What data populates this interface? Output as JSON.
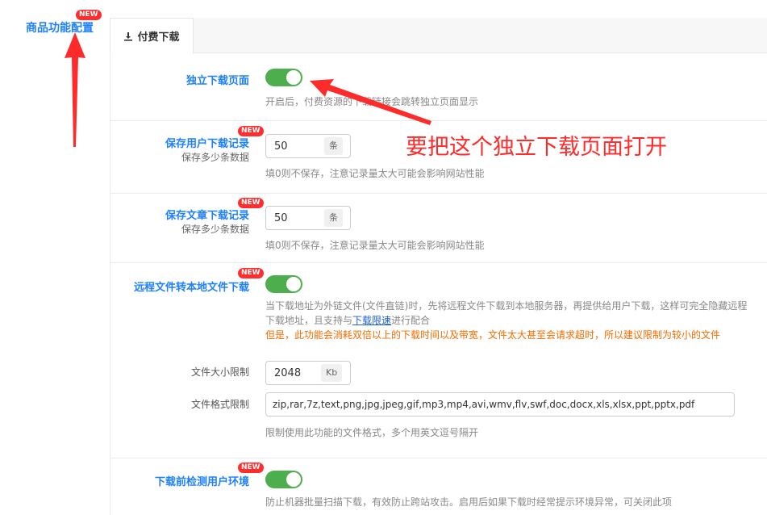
{
  "sidebar": {
    "item_label": "商品功能配置",
    "badge": "NEW"
  },
  "tab": {
    "label": "付费下载",
    "icon": "download-icon"
  },
  "settings": {
    "standalone_page": {
      "label": "独立下载页面",
      "enabled": true,
      "help": "开启后，付费资源的下载链接会跳转独立页面显示"
    },
    "save_user_records": {
      "label": "保存用户下载记录",
      "badge": "NEW",
      "sublabel": "保存多少条数据",
      "value": "50",
      "unit": "条",
      "help": "填0则不保存，注意记录量太大可能会影响网站性能"
    },
    "save_post_records": {
      "label": "保存文章下载记录",
      "badge": "NEW",
      "sublabel": "保存多少条数据",
      "value": "50",
      "unit": "条",
      "help": "填0则不保存，注意记录量太大可能会影响网站性能"
    },
    "remote_to_local": {
      "label": "远程文件转本地文件下载",
      "badge": "NEW",
      "enabled": true,
      "help_before_link": "当下载地址为外链文件(文件直链)时，先将远程文件下载到本地服务器，再提供给用户下载，这样可完全隐藏远程下载地址，且支持与",
      "help_link": "下载限速",
      "help_after_link": "进行配合",
      "warning": "但是，此功能会消耗双倍以上的下载时间以及带宽，文件太大甚至会请求超时，所以建议限制为较小的文件",
      "size_limit_label": "文件大小限制",
      "size_limit_value": "2048",
      "size_limit_unit": "Kb",
      "format_limit_label": "文件格式限制",
      "format_limit_value": "zip,rar,7z,text,png,jpg,jpeg,gif,mp3,mp4,avi,wmv,flv,swf,doc,docx,xls,xlsx,ppt,pptx,pdf",
      "format_help": "限制使用此功能的文件格式，多个用英文逗号隔开"
    },
    "env_check": {
      "label": "下载前检测用户环境",
      "badge": "NEW",
      "enabled": true,
      "help": "防止机器批量扫描下载，有效防止跨站攻击。启用后如果下载时经常提示环境异常，可关闭此项"
    }
  },
  "annotation": {
    "text": "要把这个独立下载页面打开",
    "color": "#ff2a2a"
  },
  "colors": {
    "accent": "#1e80ff",
    "toggle_on": "#4cae4c",
    "badge": "#ff2d2d",
    "warning": "#f56c00"
  }
}
